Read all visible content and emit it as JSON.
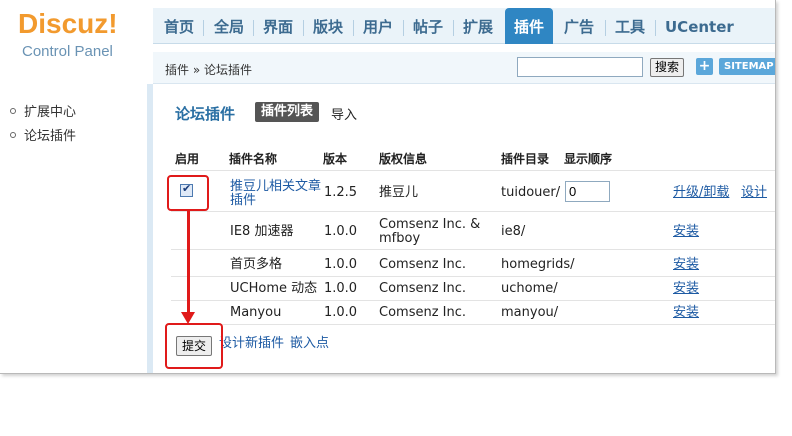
{
  "logo": {
    "main": "Discuz",
    "bang": "!",
    "sub": "Control Panel"
  },
  "nav": {
    "tabs": [
      {
        "label": "首页"
      },
      {
        "label": "全局"
      },
      {
        "label": "界面"
      },
      {
        "label": "版块"
      },
      {
        "label": "用户"
      },
      {
        "label": "帖子"
      },
      {
        "label": "扩展"
      },
      {
        "label": "插件"
      },
      {
        "label": "广告"
      },
      {
        "label": "工具"
      },
      {
        "label": "UCenter"
      }
    ],
    "active_index": 7
  },
  "subbar": {
    "breadcrumb": "插件 » 论坛插件",
    "search_value": "",
    "search_button": "搜索",
    "plus_button": "+",
    "sitemap_button": "SITEMAP"
  },
  "sidebar": {
    "items": [
      {
        "label": "扩展中心"
      },
      {
        "label": "论坛插件"
      }
    ]
  },
  "main": {
    "title": "论坛插件",
    "tab_active": "插件列表",
    "tab_other": "导入",
    "columns": {
      "enable": "启用",
      "name": "插件名称",
      "version": "版本",
      "copyright": "版权信息",
      "dir": "插件目录",
      "order": "显示顺序"
    },
    "rows": [
      {
        "name_line1": "推豆儿相关文章",
        "name_line2": "插件",
        "version": "1.2.5",
        "copyright_line1": "推豆儿",
        "copyright_line2": "",
        "dir": "tuidouer/",
        "order": "0",
        "action1": "升级/卸载",
        "action2": "设计",
        "enabled": true
      },
      {
        "name": "IE8 加速器",
        "version": "1.0.0",
        "copyright_line1": "Comsenz Inc. &",
        "copyright_line2": "mfboy",
        "dir": "ie8/",
        "action1": "安装"
      },
      {
        "name": "首页多格",
        "version": "1.0.0",
        "copyright": "Comsenz Inc.",
        "dir": "homegrids/",
        "action1": "安装"
      },
      {
        "name": "UCHome 动态",
        "version": "1.0.0",
        "copyright": "Comsenz Inc.",
        "dir": "uchome/",
        "action1": "安装"
      },
      {
        "name": "Manyou",
        "version": "1.0.0",
        "copyright": "Comsenz Inc.",
        "dir": "manyou/",
        "action1": "安装"
      }
    ],
    "submit_button": "提交",
    "footer_links": [
      {
        "label": "设计新插件"
      },
      {
        "label": "嵌入点"
      }
    ]
  },
  "colors": {
    "accent": "#2f86c3",
    "logo": "#f29a2e",
    "annotation": "#e01a1a",
    "link": "#1d5aa3"
  }
}
